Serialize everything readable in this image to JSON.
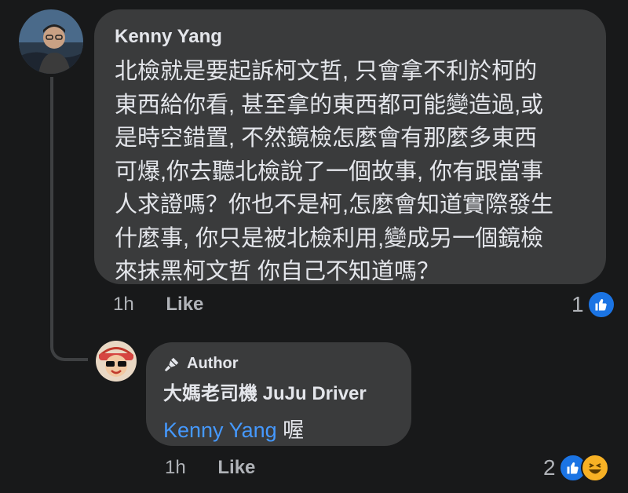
{
  "comment": {
    "author": "Kenny Yang",
    "text": "北檢就是要起訴柯文哲, 只會拿不利於柯的\n東西給你看, 甚至拿的東西都可能變造過,或\n是時空錯置, 不然鏡檢怎麼會有那麼多東西\n可爆,你去聽北檢說了一個故事, 你有跟當事\n人求證嗎？你也不是柯,怎麼會知道實際發生\n什麼事, 你只是被北檢利用,變成另一個鏡檢\n來抹黑柯文哲 你自己不知道嗎？",
    "time": "1h",
    "like_label": "Like",
    "reaction_count": "1",
    "reactions": [
      "like-icon"
    ]
  },
  "reply": {
    "badge": "Author",
    "author": "大媽老司機 JuJu Driver",
    "mention": "Kenny Yang",
    "text": " 喔",
    "time": "1h",
    "like_label": "Like",
    "reaction_count": "2",
    "reactions": [
      "like-icon",
      "haha-icon"
    ]
  },
  "colors": {
    "background": "#18191a",
    "bubble": "#3a3b3c",
    "mention": "#4599ff",
    "like": "#1b74e4",
    "haha": "#f7b125"
  }
}
